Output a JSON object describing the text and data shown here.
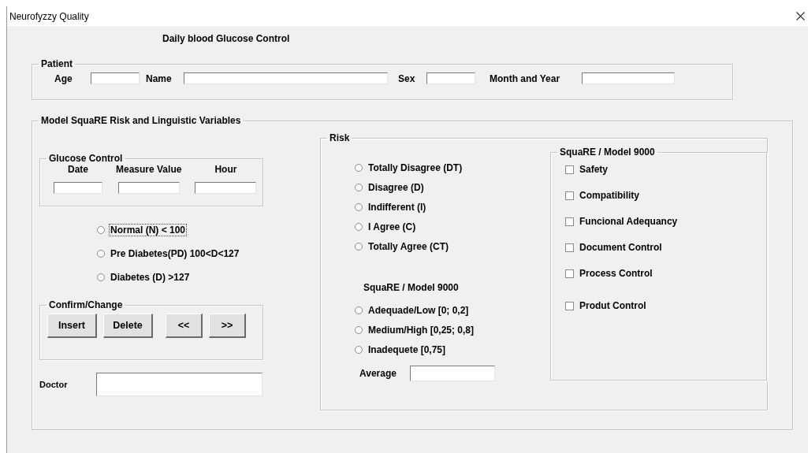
{
  "window": {
    "title": "Neurofyzzy Quality"
  },
  "heading": "Daily blood Glucose Control",
  "patient": {
    "legend": "Patient",
    "fields": [
      {
        "label": "Age"
      },
      {
        "label": "Name"
      },
      {
        "label": "Sex"
      },
      {
        "label": "Month and Year"
      }
    ]
  },
  "model": {
    "legend": "Model SquaRE Risk and Linguistic Variables",
    "glucose_control": {
      "legend": "Glucose Control",
      "fields": [
        {
          "label": "Date"
        },
        {
          "label": "Measure Value"
        },
        {
          "label": "Hour"
        }
      ]
    },
    "glucose_levels": [
      {
        "label": "Normal (N) < 100",
        "selected": false,
        "focused": true
      },
      {
        "label": "Pre Diabetes(PD) 100<D<127",
        "selected": false,
        "focused": false
      },
      {
        "label": "Diabetes (D) >127",
        "selected": false,
        "focused": false
      }
    ],
    "confirm_change": {
      "legend": "Confirm/Change",
      "buttons": [
        "Insert",
        "Delete",
        "<<",
        ">>"
      ]
    },
    "doctor": {
      "label": "Doctor"
    },
    "risk": {
      "legend": "Risk",
      "agreement": [
        {
          "label": "Totally Disagree (DT)",
          "selected": false
        },
        {
          "label": "Disagree (D)",
          "selected": false
        },
        {
          "label": "Indifferent (I)",
          "selected": false
        },
        {
          "label": "I Agree (C)",
          "selected": false
        },
        {
          "label": "Totally Agree (CT)",
          "selected": false
        }
      ],
      "levels_title": "SquaRE / Model 9000",
      "levels": [
        {
          "label": "Adequade/Low [0; 0,2]",
          "selected": false
        },
        {
          "label": "Medium/High [0,25; 0,8]",
          "selected": false
        },
        {
          "label": "Inadequete [0,75]",
          "selected": false
        }
      ],
      "average": {
        "label": "Average"
      },
      "square_model": {
        "legend": "SquaRE / Model 9000",
        "items": [
          {
            "label": "Safety",
            "checked": false
          },
          {
            "label": "Compatibility",
            "checked": false
          },
          {
            "label": "Funcional Adequancy",
            "checked": false
          },
          {
            "label": "Document Control",
            "checked": false
          },
          {
            "label": "Process Control",
            "checked": false
          },
          {
            "label": "Produt Control",
            "checked": false
          }
        ]
      }
    }
  }
}
